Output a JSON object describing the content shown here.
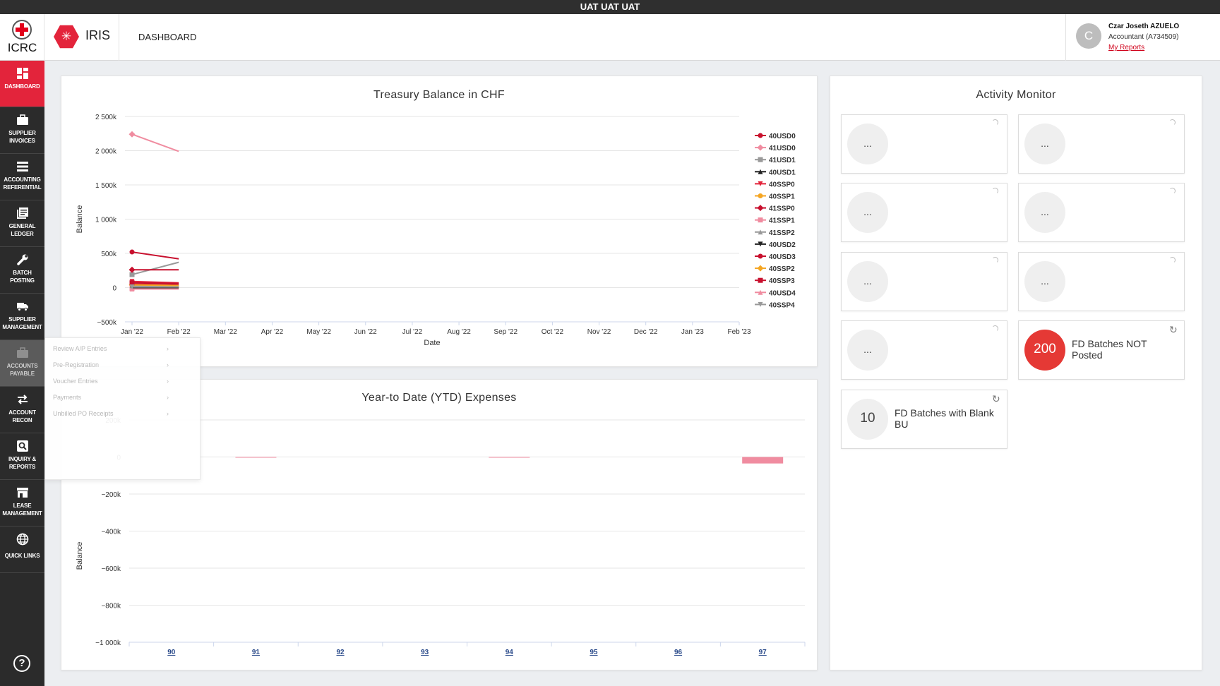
{
  "env_banner": "UAT UAT UAT",
  "header": {
    "org_logo_text": "ICRC",
    "app_name": "IRIS",
    "page_name": "DASHBOARD",
    "user": {
      "avatar_letter": "C",
      "name": "Czar Joseth AZUELO",
      "role": "Accountant (A734509)",
      "reports_link": "My Reports"
    }
  },
  "sidebar": {
    "items": [
      {
        "label": "DASHBOARD",
        "icon": "dashboard-icon",
        "active": true
      },
      {
        "label": "SUPPLIER INVOICES",
        "icon": "briefcase-icon"
      },
      {
        "label": "ACCOUNTING REFERENTIAL",
        "icon": "list-icon"
      },
      {
        "label": "GENERAL LEDGER",
        "icon": "ledger-icon"
      },
      {
        "label": "BATCH POSTING",
        "icon": "wrench-icon"
      },
      {
        "label": "SUPPLIER MANAGEMENT",
        "icon": "truck-icon"
      },
      {
        "label": "ACCOUNTS PAYABLE",
        "icon": "briefcase-icon",
        "hover": true
      },
      {
        "label": "ACCOUNT RECON",
        "icon": "arrows-icon"
      },
      {
        "label": "INQUIRY & REPORTS",
        "icon": "search-icon"
      },
      {
        "label": "LEASE MANAGEMENT",
        "icon": "store-icon"
      },
      {
        "label": "QUICK LINKS",
        "icon": "globe-icon"
      }
    ],
    "help_icon": "help-icon"
  },
  "flyout_menu": {
    "items": [
      "Review A/P Entries",
      "Pre-Registration",
      "Voucher Entries",
      "Payments",
      "Unbilled PO Receipts"
    ]
  },
  "activity_monitor": {
    "title": "Activity Monitor",
    "tiles": [
      {
        "value": "...",
        "label": "",
        "state": "loading"
      },
      {
        "value": "...",
        "label": "",
        "state": "loading"
      },
      {
        "value": "...",
        "label": "",
        "state": "loading"
      },
      {
        "value": "...",
        "label": "",
        "state": "loading"
      },
      {
        "value": "...",
        "label": "",
        "state": "loading"
      },
      {
        "value": "...",
        "label": "",
        "state": "loading"
      },
      {
        "value": "...",
        "label": "",
        "state": "loading"
      },
      {
        "value": "200",
        "label": "FD Batches NOT Posted",
        "state": "alert"
      },
      {
        "value": "10",
        "label": "FD Batches with Blank BU",
        "state": "normal"
      }
    ],
    "colors": {
      "alert": "#e53935",
      "neutral": "#efefef"
    }
  },
  "chart_data": [
    {
      "type": "line",
      "title": "Treasury Balance in CHF",
      "xlabel": "Date",
      "ylabel": "Balance",
      "x_ticks": [
        "Jan '22",
        "Feb '22",
        "Mar '22",
        "Apr '22",
        "May '22",
        "Jun '22",
        "Jul '22",
        "Aug '22",
        "Sep '22",
        "Oct '22",
        "Nov '22",
        "Dec '22",
        "Jan '23",
        "Feb '23"
      ],
      "y_ticks": [
        "2 500k",
        "2 000k",
        "1 500k",
        "1 000k",
        "500k",
        "0",
        "−500k"
      ],
      "ylim": [
        -500000,
        2500000
      ],
      "x": [
        "Jan '22",
        "Feb '22"
      ],
      "legend_position": "right",
      "grid": true,
      "series": [
        {
          "name": "40USD0",
          "color": "#c8102e",
          "marker": "circle",
          "values": [
            520000,
            420000
          ]
        },
        {
          "name": "41USD0",
          "color": "#f08ca0",
          "marker": "diamond",
          "values": [
            2240000,
            1990000
          ]
        },
        {
          "name": "41USD1",
          "color": "#999999",
          "marker": "square",
          "values": [
            190000,
            370000
          ]
        },
        {
          "name": "40USD1",
          "color": "#222222",
          "marker": "triangle",
          "values": [
            10000,
            10000
          ]
        },
        {
          "name": "40SSP0",
          "color": "#e3243b",
          "marker": "triangle-down",
          "values": [
            90000,
            70000
          ]
        },
        {
          "name": "40SSP1",
          "color": "#f5a623",
          "marker": "circle",
          "values": [
            20000,
            20000
          ]
        },
        {
          "name": "41SSP0",
          "color": "#c8102e",
          "marker": "diamond",
          "values": [
            260000,
            260000
          ]
        },
        {
          "name": "41SSP1",
          "color": "#f08ca0",
          "marker": "square",
          "values": [
            -10000,
            -10000
          ]
        },
        {
          "name": "41SSP2",
          "color": "#999999",
          "marker": "triangle",
          "values": [
            30000,
            30000
          ]
        },
        {
          "name": "40USD2",
          "color": "#222222",
          "marker": "triangle-down",
          "values": [
            0,
            0
          ]
        },
        {
          "name": "40USD3",
          "color": "#c8102e",
          "marker": "circle",
          "values": [
            50000,
            40000
          ]
        },
        {
          "name": "40SSP2",
          "color": "#f5a623",
          "marker": "diamond",
          "values": [
            40000,
            30000
          ]
        },
        {
          "name": "40SSP3",
          "color": "#c8102e",
          "marker": "square",
          "values": [
            70000,
            60000
          ]
        },
        {
          "name": "40USD4",
          "color": "#f08ca0",
          "marker": "triangle",
          "values": [
            -20000,
            -20000
          ]
        },
        {
          "name": "40SSP4",
          "color": "#999999",
          "marker": "triangle-down",
          "values": [
            10000,
            10000
          ]
        }
      ]
    },
    {
      "type": "bar",
      "title": "Year-to Date (YTD) Expenses",
      "xlabel": "",
      "ylabel": "Balance",
      "categories": [
        "90",
        "91",
        "92",
        "93",
        "94",
        "95",
        "96",
        "97"
      ],
      "y_ticks": [
        "200k",
        "0",
        "−200k",
        "−400k",
        "−600k",
        "−800k",
        "−1 000k"
      ],
      "ylim": [
        -1000000,
        200000
      ],
      "grid": true,
      "series": [
        {
          "color": "#f08ca0",
          "values": [
            0,
            -2000,
            0,
            0,
            -2000,
            0,
            0,
            -35000
          ]
        }
      ]
    }
  ]
}
